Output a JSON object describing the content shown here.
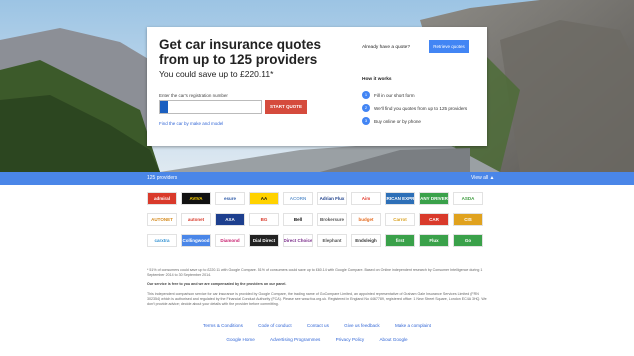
{
  "hero": {
    "headline_line1": "Get car insurance quotes",
    "headline_line2": "from up to 125 providers",
    "saving": "You could save up to £220.11*",
    "reg_label": "Enter the car's registration number",
    "start_button": "START QUOTE",
    "find_link": "Find the car by make and model",
    "already_quote": "Already have a quote?",
    "retrieve_button": "Retrieve quotes",
    "how_it_works": "How it works",
    "steps": [
      {
        "n": "1",
        "text": "Fill in our short form"
      },
      {
        "n": "2",
        "text": "We'll find you quotes from up to 125 providers"
      },
      {
        "n": "3",
        "text": "Buy online or by phone"
      }
    ]
  },
  "providers_bar": {
    "count": "125 providers",
    "view_all": "View all ▲"
  },
  "providers": [
    {
      "label": "admiral",
      "color": "#ffffff",
      "bg": "#d93a2b"
    },
    {
      "label": "AVIVA",
      "color": "#ffd400",
      "bg": "#111111"
    },
    {
      "label": "esure",
      "color": "#2d5aa8",
      "bg": "#ffffff"
    },
    {
      "label": "AA",
      "color": "#111111",
      "bg": "#ffd200"
    },
    {
      "label": "ACORN",
      "color": "#6a9bd1",
      "bg": "#ffffff"
    },
    {
      "label": "Adrian Flux",
      "color": "#1c3f8a",
      "bg": "#ffffff"
    },
    {
      "label": "Aim",
      "color": "#e33b2e",
      "bg": "#ffffff"
    },
    {
      "label": "AMERICAN EXPRESS",
      "color": "#ffffff",
      "bg": "#2d6fb7"
    },
    {
      "label": "ANY DRIVER",
      "color": "#ffffff",
      "bg": "#3aa14a"
    },
    {
      "label": "ASDA",
      "color": "#3c9a3c",
      "bg": "#ffffff"
    },
    {
      "label": "AUTONET",
      "color": "#d48a1e",
      "bg": "#ffffff"
    },
    {
      "label": "autonet",
      "color": "#d93a2b",
      "bg": "#ffffff"
    },
    {
      "label": "AXA",
      "color": "#ffffff",
      "bg": "#1d3f8e"
    },
    {
      "label": "BG",
      "color": "#d93a2b",
      "bg": "#ffffff"
    },
    {
      "label": "Bell",
      "color": "#111111",
      "bg": "#ffffff"
    },
    {
      "label": "Brokersure",
      "color": "#555555",
      "bg": "#ffffff"
    },
    {
      "label": "budget",
      "color": "#e56b1f",
      "bg": "#ffffff"
    },
    {
      "label": "Carrot",
      "color": "#d9a01e",
      "bg": "#ffffff"
    },
    {
      "label": "CAR",
      "color": "#ffffff",
      "bg": "#d93a2b"
    },
    {
      "label": "CIS",
      "color": "#ffffff",
      "bg": "#e0a21e"
    },
    {
      "label": "carxtra",
      "color": "#2d8fd1",
      "bg": "#ffffff"
    },
    {
      "label": "Collingwood",
      "color": "#ffffff",
      "bg": "#4a86e8"
    },
    {
      "label": "Diamond",
      "color": "#c8206f",
      "bg": "#ffffff"
    },
    {
      "label": "Dial Direct",
      "color": "#ffffff",
      "bg": "#222222"
    },
    {
      "label": "Direct Choice",
      "color": "#7a2c8a",
      "bg": "#ffffff"
    },
    {
      "label": "Elephant",
      "color": "#555555",
      "bg": "#ffffff"
    },
    {
      "label": "Endsleigh",
      "color": "#333333",
      "bg": "#ffffff"
    },
    {
      "label": "first",
      "color": "#ffffff",
      "bg": "#3aa14a"
    },
    {
      "label": "Flux",
      "color": "#ffffff",
      "bg": "#3aa14a"
    },
    {
      "label": "Go",
      "color": "#ffffff",
      "bg": "#3aa14a"
    }
  ],
  "footer": {
    "disclaimer1": "* 51% of consumers could save up to £220.11 with Google Compare. 51% of consumers could save up to £60.14 with Google Compare. Based on Online independent research by Consumer Intelligence during 1 September 2014 to 30 September 2014.",
    "disclaimer2": "Our service is free to you and we are compensated by the providers on our panel.",
    "disclaimer3": "This independent comparison service for car insurance is provided by Google Compare, the trading name of GoCompare Limited, an appointed representative of Graham Gale Insurance Services Limited (FRN 302354) which is authorised and regulated by the Financial Conduct Authority (FCA). Please see www.fca.org.uk. Registered in England No 4467789, registered office: 1 New Street Square, London EC4A 3HQ. We don't provide advice; decide about your details with the provider before committing.",
    "links_row1": [
      "Terms & Conditions",
      "Code of conduct",
      "Contact us",
      "Give us feedback",
      "Make a complaint"
    ],
    "links_row2": [
      "Google Home",
      "Advertising Programmes",
      "Privacy Policy",
      "About Google"
    ]
  }
}
